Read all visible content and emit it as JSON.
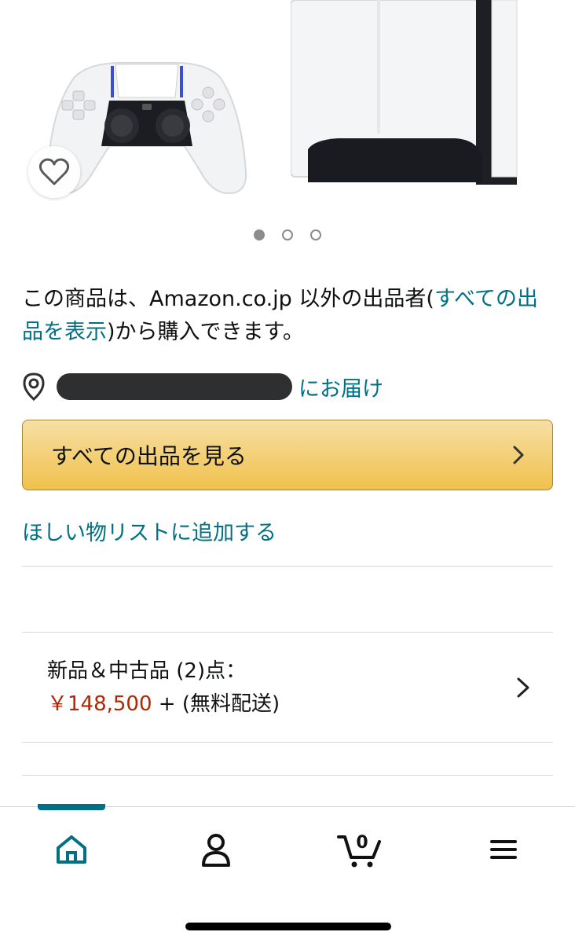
{
  "carousel": {
    "dot_count": 3,
    "active_index": 0
  },
  "notice": {
    "prefix": "この商品は、Amazon.co.jp 以外の出品者(",
    "link": "すべての出品を表示",
    "suffix": ")から購入できます。"
  },
  "delivery": {
    "text": "にお届け"
  },
  "see_all_button": {
    "label": "すべての出品を見る"
  },
  "wishlist": {
    "label": "ほしい物リストに追加する"
  },
  "offers": {
    "label": "新品＆中古品 (2)点：",
    "price": "￥148,500",
    "shipping": " + (無料配送)"
  },
  "nav": {
    "cart_count": "0",
    "accent": "#007185"
  },
  "colors": {
    "link": "#007185",
    "price": "#b12704",
    "button_top": "#f7dfa5",
    "button_bottom": "#f0c14b"
  }
}
